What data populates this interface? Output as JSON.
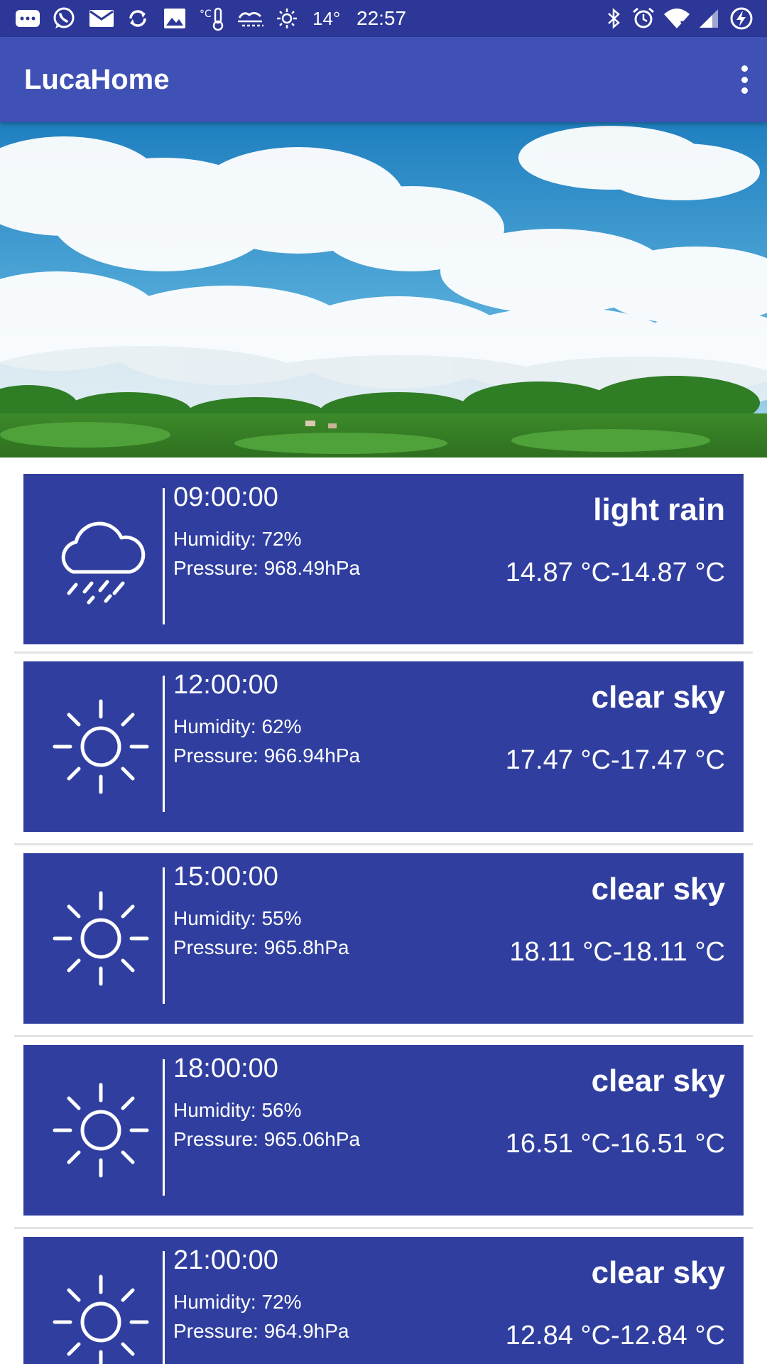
{
  "status_bar": {
    "weather_temp": "14°",
    "time": "22:57",
    "left_icons": [
      "messages-icon",
      "whatsapp-icon",
      "email-icon",
      "sync-icon",
      "gallery-icon",
      "thermometer-icon",
      "fog-icon",
      "sun-icon"
    ],
    "right_icons": [
      "bluetooth-icon",
      "alarm-icon",
      "wifi-icon",
      "signal-icon",
      "battery-charging-icon"
    ]
  },
  "app_bar": {
    "title": "LucaHome",
    "menu_icon": "overflow-menu-icon"
  },
  "colors": {
    "status_bar": "#2c3797",
    "app_bar": "#3f51b5",
    "card": "#303f9f",
    "divider": "#e3e3e3",
    "sky": "#2e93c7"
  },
  "forecasts": [
    {
      "icon": "rain-cloud-icon",
      "time": "09:00:00",
      "humidity": "Humidity: 72%",
      "pressure": "Pressure: 968.49hPa",
      "description": "light rain",
      "temperature": "14.87 °C-14.87 °C"
    },
    {
      "icon": "sun-icon",
      "time": "12:00:00",
      "humidity": "Humidity: 62%",
      "pressure": "Pressure: 966.94hPa",
      "description": "clear sky",
      "temperature": "17.47 °C-17.47 °C"
    },
    {
      "icon": "sun-icon",
      "time": "15:00:00",
      "humidity": "Humidity: 55%",
      "pressure": "Pressure: 965.8hPa",
      "description": "clear sky",
      "temperature": "18.11 °C-18.11 °C"
    },
    {
      "icon": "sun-icon",
      "time": "18:00:00",
      "humidity": "Humidity: 56%",
      "pressure": "Pressure: 965.06hPa",
      "description": "clear sky",
      "temperature": "16.51 °C-16.51 °C"
    },
    {
      "icon": "sun-icon",
      "time": "21:00:00",
      "humidity": "Humidity: 72%",
      "pressure": "Pressure: 964.9hPa",
      "description": "clear sky",
      "temperature": "12.84 °C-12.84 °C"
    }
  ]
}
